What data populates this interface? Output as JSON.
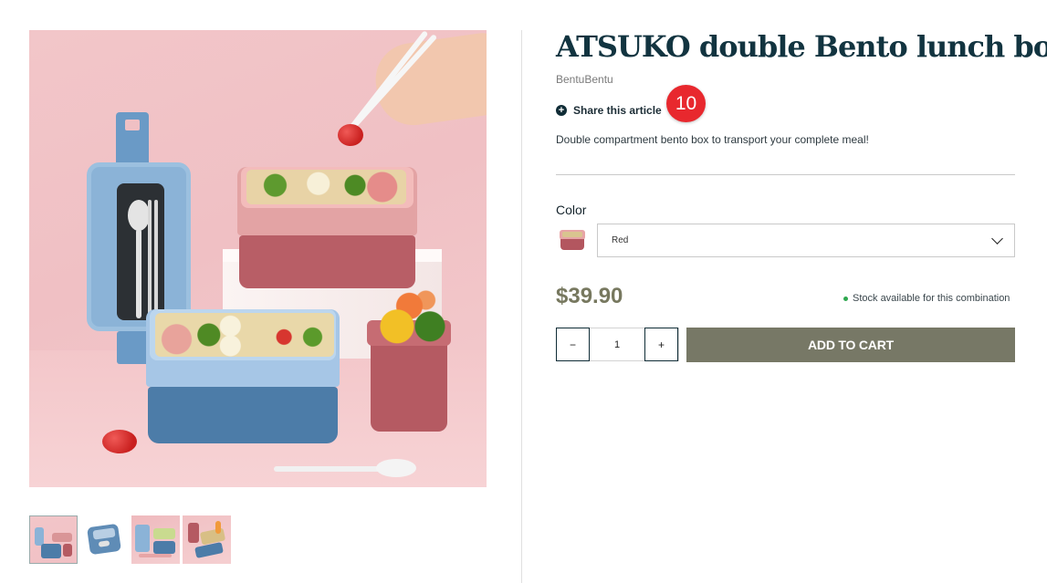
{
  "product": {
    "title": "ATSUKO double Bento lunch box",
    "brand": "BentuBentu",
    "description": "Double compartment bento box to transport your complete meal!"
  },
  "share": {
    "label": "Share this article",
    "icon": "plus-circle-icon",
    "badge_count": "10"
  },
  "options": {
    "color_label": "Color",
    "selected_color": "Red"
  },
  "pricing": {
    "price": "$39.90",
    "stock_status": "Stock available for this combination"
  },
  "cart": {
    "quantity": "1",
    "decrement_label": "−",
    "increment_label": "+",
    "add_to_cart_label": "ADD TO CART"
  },
  "colors": {
    "title": "#123440",
    "price": "#77785f",
    "add_to_cart_bg": "#777866",
    "badge": "#e8282e",
    "stock_dot": "#2fa84f"
  },
  "gallery": {
    "thumbnail_count": 4,
    "active_index": 0
  }
}
